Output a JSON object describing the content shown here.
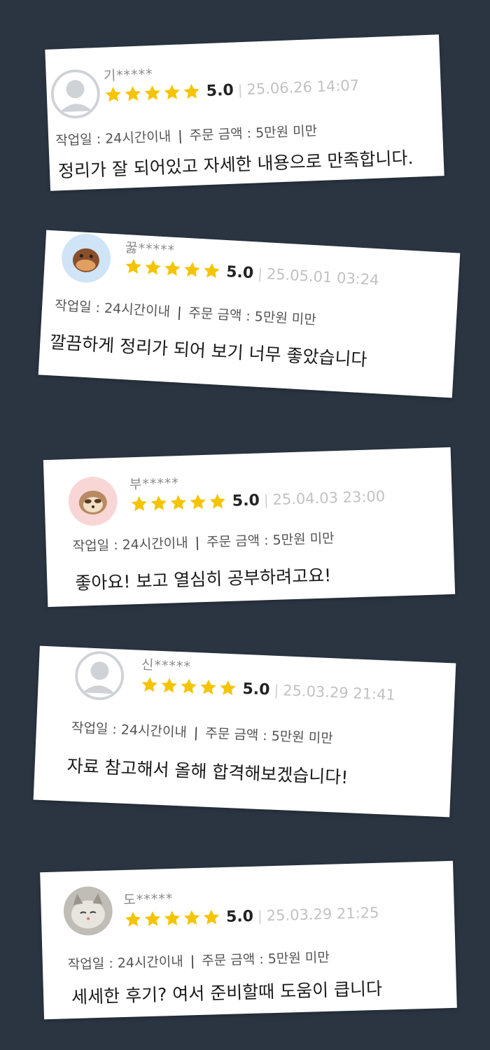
{
  "colors": {
    "background": "#2b3542",
    "star": "#f5c400",
    "card": "#ffffff"
  },
  "reviews": [
    {
      "user": "기*****",
      "avatar": "default-avatar-icon",
      "score": "5.0",
      "separator": "|",
      "date": "25.06.26 14:07",
      "work_label": "작업일 : 24시간이내",
      "meta_sep": "|",
      "amount_label": "주문 금액 : 5만원 미만",
      "comment": "정리가 잘 되어있고 자세한 내용으로 만족합니다."
    },
    {
      "user": "꿇*****",
      "avatar": "platypus-avatar-icon",
      "score": "5.0",
      "separator": "|",
      "date": "25.05.01 03:24",
      "work_label": "작업일 : 24시간이내",
      "meta_sep": "|",
      "amount_label": "주문 금액 : 5만원 미만",
      "comment": "깔끔하게 정리가 되어 보기 너무 좋았습니다"
    },
    {
      "user": "부*****",
      "avatar": "sloth-avatar-icon",
      "score": "5.0",
      "separator": "|",
      "date": "25.04.03 23:00",
      "work_label": "작업일 : 24시간이내",
      "meta_sep": "|",
      "amount_label": "주문 금액 : 5만원 미만",
      "comment": "좋아요! 보고 열심히 공부하려고요!"
    },
    {
      "user": "신*****",
      "avatar": "default-avatar-icon",
      "score": "5.0",
      "separator": "|",
      "date": "25.03.29 21:41",
      "work_label": "작업일 : 24시간이내",
      "meta_sep": "|",
      "amount_label": "주문 금액 : 5만원 미만",
      "comment": "자료 참고해서 올해 합격해보겠습니다!"
    },
    {
      "user": "도*****",
      "avatar": "cat-avatar-icon",
      "score": "5.0",
      "separator": "|",
      "date": "25.03.29 21:25",
      "work_label": "작업일 : 24시간이내",
      "meta_sep": "|",
      "amount_label": "주문 금액 : 5만원 미만",
      "comment": "세세한 후기? 여서 준비할때 도움이 큽니다"
    }
  ]
}
